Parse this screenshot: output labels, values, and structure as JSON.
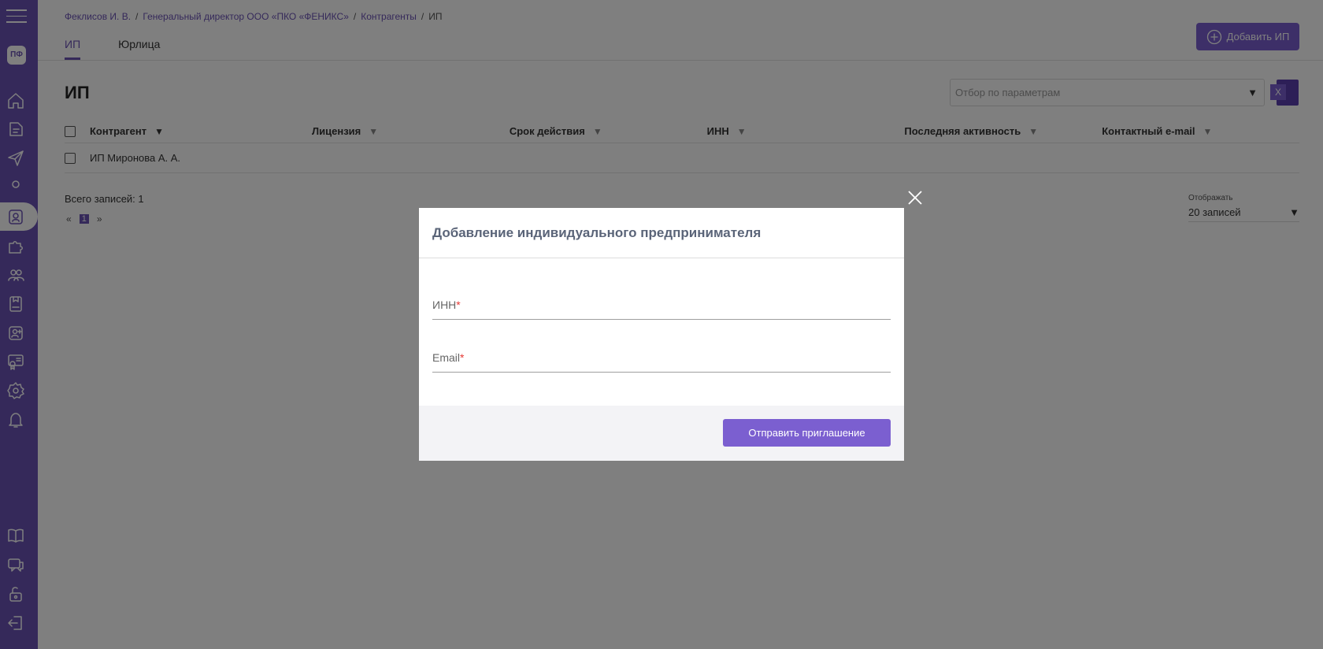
{
  "sidebar": {
    "avatar_initials": "ПФ",
    "icons": [
      "home-icon",
      "document-icon",
      "send-icon",
      "user-icon",
      "counterparty-icon",
      "puzzle-icon",
      "users-group-icon",
      "license-icon",
      "user-plus-icon",
      "certificate-icon",
      "settings-icon",
      "bell-icon",
      "book-icon",
      "chat-icon",
      "lock-icon",
      "logout-icon"
    ]
  },
  "breadcrumb": {
    "items": [
      "Феклисов И. В.",
      "Генеральный директор ООО «ПКО «ФЕНИКС»",
      "Контрагенты"
    ],
    "separator": "/",
    "current": "ИП"
  },
  "tabs": [
    {
      "label": "ИП",
      "active": true
    },
    {
      "label": "Юрлица",
      "active": false
    }
  ],
  "header": {
    "add_button_label": "Добавить ИП"
  },
  "page": {
    "title": "ИП",
    "filter_placeholder": "Отбор по параметрам",
    "excel_label": "X"
  },
  "table": {
    "columns": [
      "Контрагент",
      "Лицензия",
      "Срок действия",
      "ИНН",
      "Последняя активность",
      "Контактный e-mail"
    ],
    "rows": [
      [
        "ИП Миронова А. А.",
        "",
        "",
        "",
        "",
        ""
      ]
    ]
  },
  "footer": {
    "total_label": "Всего записей: 1",
    "pager_prev": "«",
    "pager_current": "1",
    "pager_next": "»",
    "per_page_label": "Отображать",
    "per_page_value": "20 записей"
  },
  "modal": {
    "title": "Добавление индивидуального предпринимателя",
    "fields": [
      {
        "label": "ИНН",
        "required_mark": "*"
      },
      {
        "label": "Email",
        "required_mark": "*"
      }
    ],
    "submit_label": "Отправить приглашение"
  },
  "colors": {
    "accent": "#6b52b5",
    "button": "#7b5fd0",
    "required": "#e53935"
  }
}
